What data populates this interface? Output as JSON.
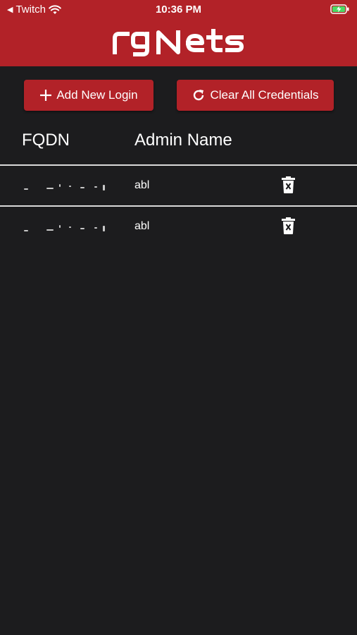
{
  "status_bar": {
    "back_app": "Twitch",
    "time": "10:36 PM"
  },
  "header": {
    "logo_text": "rgNets",
    "color": "#b22228"
  },
  "actions": {
    "add_label": "Add New Login",
    "clear_label": "Clear All Credentials"
  },
  "table": {
    "columns": [
      "FQDN",
      "Admin Name"
    ],
    "rows": [
      {
        "fqdn": "",
        "admin": "abl"
      },
      {
        "fqdn": "",
        "admin": "abl"
      }
    ]
  },
  "icons": {
    "add": "plus-icon",
    "clear": "refresh-icon",
    "delete": "trash-icon",
    "wifi": "wifi-icon",
    "battery": "battery-charging-icon"
  }
}
